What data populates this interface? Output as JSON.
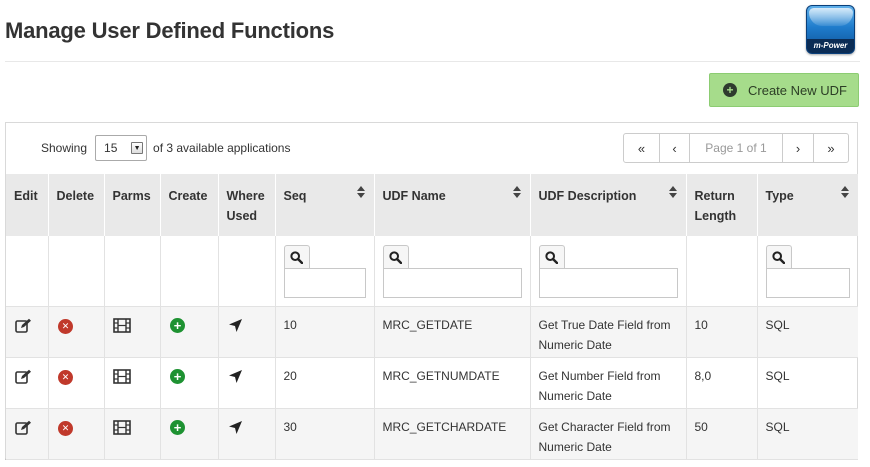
{
  "page": {
    "title": "Manage User Defined Functions",
    "logo_text": "m-Power",
    "create_button": {
      "label": "Create New UDF",
      "icon": "plus-circle-icon"
    }
  },
  "toolbar": {
    "showing_label": "Showing",
    "page_size": "15",
    "available_text": "of 3 available applications",
    "pager": {
      "first": "«",
      "prev": "‹",
      "info": "Page 1 of 1",
      "next": "›",
      "last": "»"
    }
  },
  "columns": [
    "Edit",
    "Delete",
    "Parms",
    "Create",
    "Where Used",
    "Seq",
    "UDF Name",
    "UDF Description",
    "Return Length",
    "Type"
  ],
  "rows": [
    {
      "seq": "10",
      "name": "MRC_GETDATE",
      "description": "Get True Date Field from Numeric Date",
      "length": "10",
      "type": "SQL"
    },
    {
      "seq": "20",
      "name": "MRC_GETNUMDATE",
      "description": "Get Number Field from Numeric Date",
      "length": "8,0",
      "type": "SQL"
    },
    {
      "seq": "30",
      "name": "MRC_GETCHARDATE",
      "description": "Get Character Field from Numeric Date",
      "length": "50",
      "type": "SQL"
    }
  ],
  "colors": {
    "create_button_bg": "#a6dc8b",
    "delete_icon": "#c0392b",
    "create_icon": "#1e9232",
    "header_bg": "#e9e9e9"
  }
}
